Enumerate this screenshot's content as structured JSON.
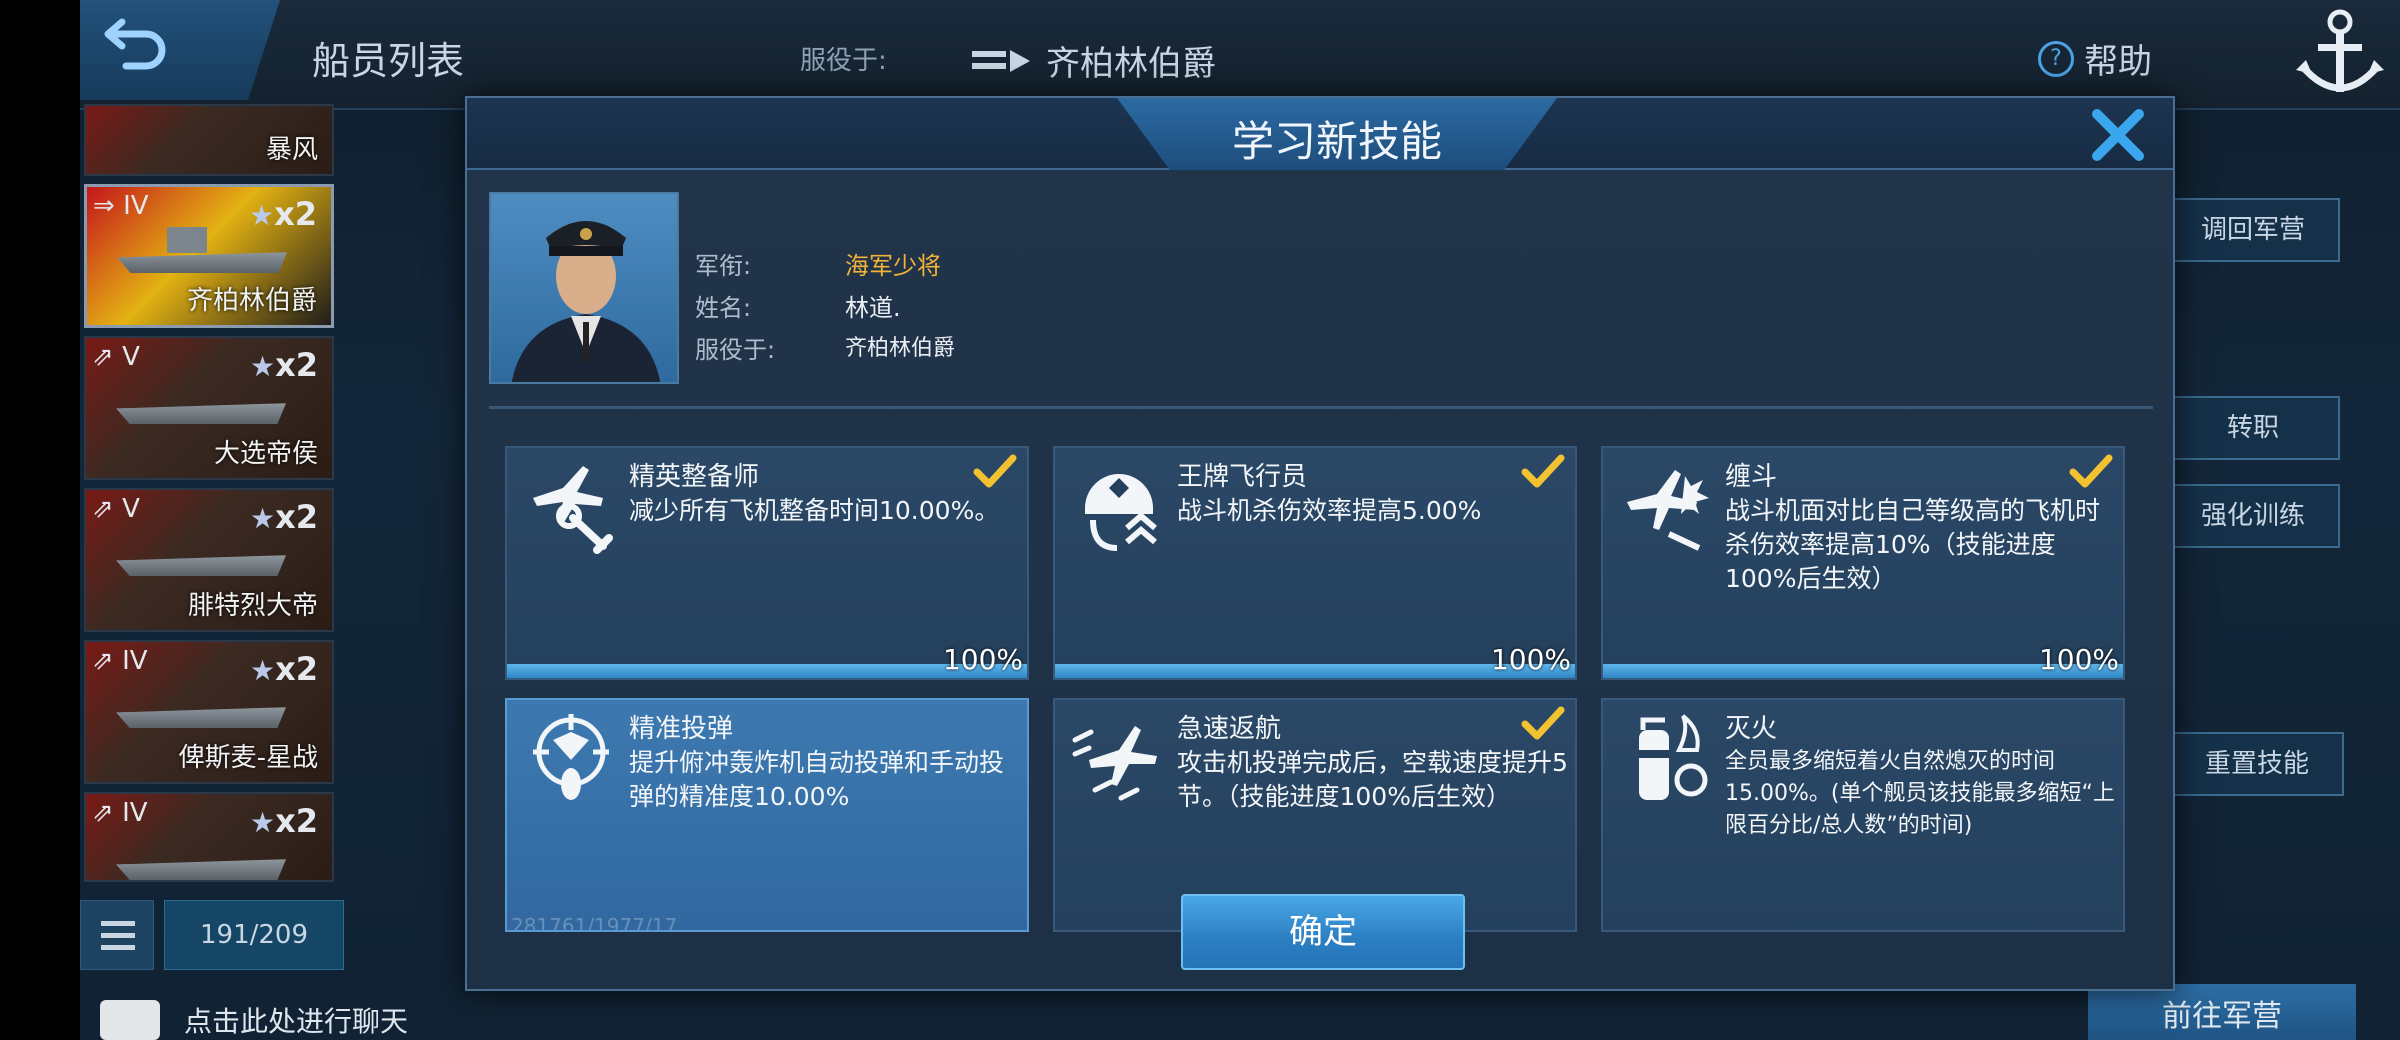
{
  "topbar": {
    "title": "船员列表",
    "serve_label": "服役于:",
    "serve_ship": "齐柏林伯爵",
    "help_label": "帮助"
  },
  "ship_list": [
    {
      "rank": "",
      "count": "",
      "name": "暴风"
    },
    {
      "rank": "IV",
      "count": "x2",
      "name": "齐柏林伯爵",
      "active": true
    },
    {
      "rank": "V",
      "count": "x2",
      "name": "大选帝侯"
    },
    {
      "rank": "V",
      "count": "x2",
      "name": "腓特烈大帝"
    },
    {
      "rank": "IV",
      "count": "x2",
      "name": "俾斯麦-星战"
    },
    {
      "rank": "IV",
      "count": "x2",
      "name": ""
    }
  ],
  "list_count": "191/209",
  "chat_hint": "点击此处进行聊天",
  "right_buttons": {
    "recall": "调回军营",
    "transfer": "转职",
    "train": "强化训练",
    "reset_skill": "重置技能",
    "goto_barracks": "前往军营"
  },
  "modal": {
    "title": "学习新技能",
    "officer": {
      "rank_label": "军衔:",
      "rank_value": "海军少将",
      "name_label": "姓名:",
      "name_value": "林道.",
      "serve_label": "服役于:",
      "serve_value": "齐柏林伯爵"
    },
    "skills": [
      {
        "name": "精英整备师",
        "desc": "减少所有飞机整备时间10.00%。",
        "checked": true,
        "progress": "100%",
        "icon": "plane-wrench-icon"
      },
      {
        "name": "王牌飞行员",
        "desc": "战斗机杀伤效率提高5.00%",
        "checked": true,
        "progress": "100%",
        "icon": "ace-pilot-icon"
      },
      {
        "name": "缠斗",
        "desc": "战斗机面对比自己等级高的飞机时杀伤效率提高10%（技能进度100%后生效）",
        "checked": true,
        "progress": "100%",
        "icon": "dogfight-icon"
      },
      {
        "name": "精准投弹",
        "desc": "提升俯冲轰炸机自动投弹和手动投弹的精准度10.00%",
        "checked": false,
        "progress": "",
        "icon": "target-bomb-icon",
        "selected": true,
        "ghost": "281761/1977/17"
      },
      {
        "name": "急速返航",
        "desc": "攻击机投弹完成后，空载速度提升5节。（技能进度100%后生效）",
        "checked": true,
        "progress": "",
        "icon": "fast-return-icon"
      },
      {
        "name": "灭火",
        "desc": "全员最多缩短着火自然熄灭的时间15.00%。(单个舰员该技能最多缩短“上限百分比/总人数”的时间)",
        "checked": false,
        "progress": "",
        "icon": "extinguisher-icon"
      }
    ],
    "confirm_label": "确定"
  },
  "colors": {
    "accent_blue": "#2f86c6",
    "gold": "#f2b338",
    "check_yellow": "#f2c230"
  }
}
